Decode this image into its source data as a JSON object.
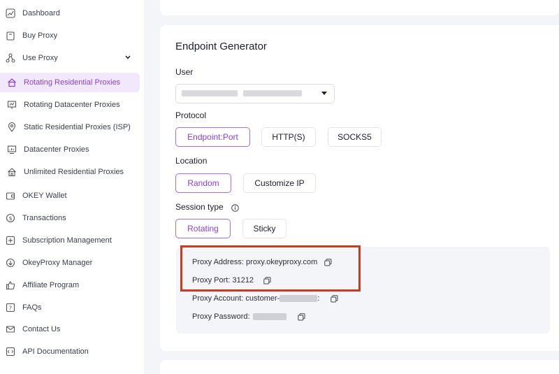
{
  "sidebar": {
    "items": [
      {
        "label": "Dashboard",
        "icon": "chart-icon"
      },
      {
        "label": "Buy Proxy",
        "icon": "bag-icon"
      },
      {
        "label": "Use Proxy",
        "icon": "network-icon"
      },
      {
        "label": "Rotating Residential Proxies",
        "icon": "home-icon"
      },
      {
        "label": "Rotating Datacenter Proxies",
        "icon": "presentation-icon"
      },
      {
        "label": "Static Residential Proxies (ISP)",
        "icon": "location-pin-icon"
      },
      {
        "label": "Datacenter Proxies",
        "icon": "monitor-icon"
      },
      {
        "label": "Unlimited Residential Proxies",
        "icon": "house-icon"
      },
      {
        "label": "OKEY Wallet",
        "icon": "wallet-icon"
      },
      {
        "label": "Transactions",
        "icon": "dollar-circle-icon"
      },
      {
        "label": "Subscription Management",
        "icon": "plus-square-icon"
      },
      {
        "label": "OkeyProxy Manager",
        "icon": "download-circle-icon"
      },
      {
        "label": "Affiliate Program",
        "icon": "thumbs-up-icon"
      },
      {
        "label": "FAQs",
        "icon": "question-icon"
      },
      {
        "label": "Contact Us",
        "icon": "mail-icon"
      },
      {
        "label": "API Documentation",
        "icon": "code-icon"
      }
    ],
    "accent": "#8a3ed8"
  },
  "generator": {
    "title": "Endpoint Generator",
    "user_label": "User",
    "protocol_label": "Protocol",
    "protocols": [
      "Endpoint:Port",
      "HTTP(S)",
      "SOCKS5"
    ],
    "location_label": "Location",
    "locations": [
      "Random",
      "Customize IP"
    ],
    "session_label": "Session type",
    "sessions": [
      "Rotating",
      "Sticky"
    ],
    "details": {
      "address": "Proxy Address: proxy.okeyproxy.com",
      "port": "Proxy Port: 31212",
      "account": "Proxy Account: customer-",
      "account_suffix": ":",
      "password": "Proxy Password:"
    }
  },
  "highlight_color": "#cc3a22"
}
